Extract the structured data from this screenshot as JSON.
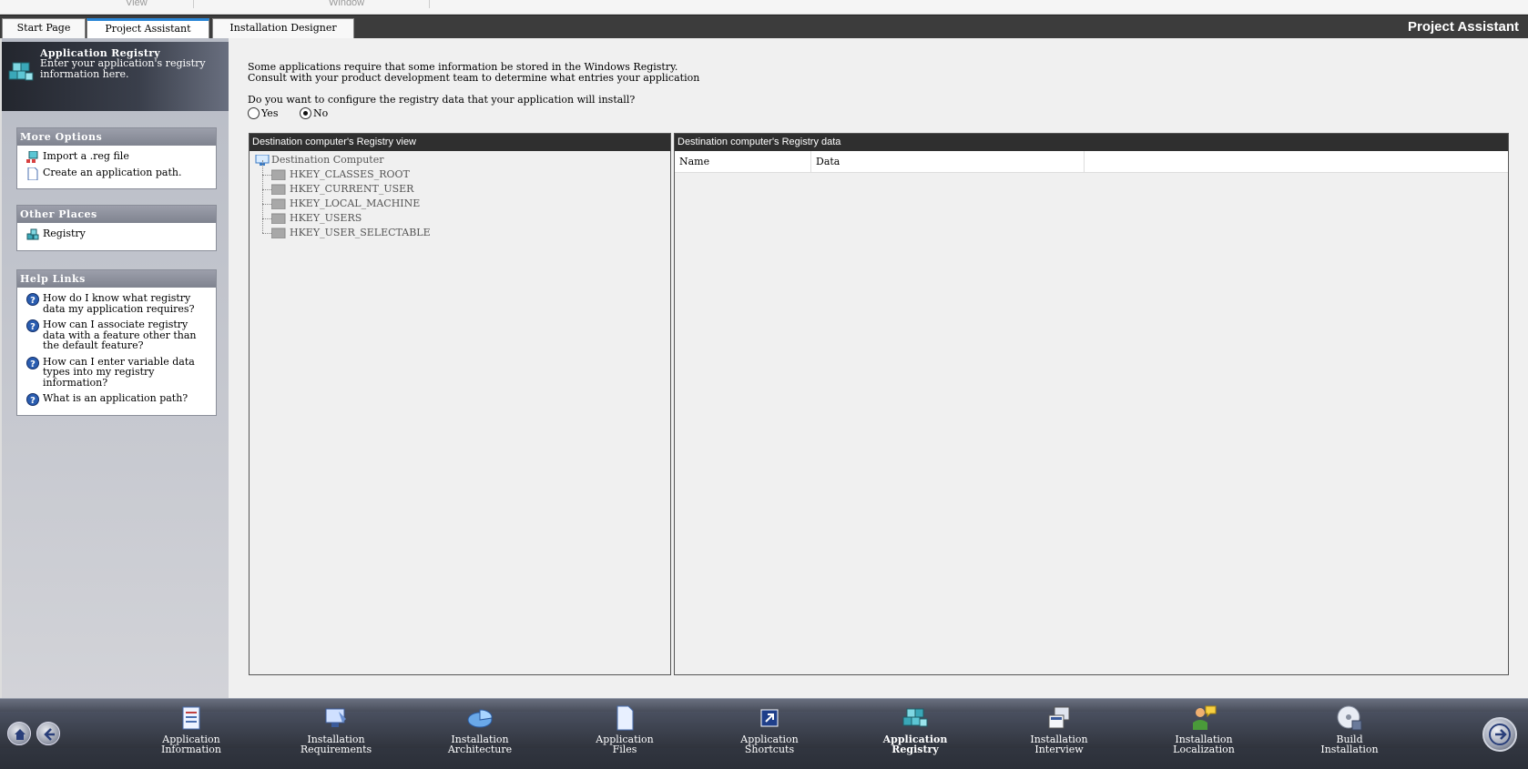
{
  "menu": {
    "view": "View",
    "window": "Window"
  },
  "tabs": [
    {
      "label": "Start Page",
      "active": false
    },
    {
      "label": "Project Assistant",
      "active": true
    },
    {
      "label": "Installation Designer",
      "active": false
    }
  ],
  "header_title": "Project Assistant",
  "sidebar": {
    "title": "Application Registry",
    "description": "Enter your application's registry information here.",
    "more_options": {
      "title": "More Options",
      "items": [
        "Import a .reg file",
        "Create an application path."
      ]
    },
    "other_places": {
      "title": "Other Places",
      "items": [
        "Registry"
      ]
    },
    "help_links": {
      "title": "Help Links",
      "items": [
        "How do I know what registry data my application requires?",
        "How can I associate registry data with a feature other than the default feature?",
        "How can I enter variable data types into my registry information?",
        "What is an application path?"
      ]
    }
  },
  "main": {
    "intro_line1": "Some applications require that some information be stored in the Windows Registry.",
    "intro_line2": "Consult with your product development team to determine what entries your application",
    "question": "Do you want to configure the registry data that your application will install?",
    "radio_yes": "Yes",
    "radio_no": "No",
    "selected": "No",
    "tree_pane_title": "Destination computer's Registry view",
    "tree": {
      "root": "Destination Computer",
      "children": [
        "HKEY_CLASSES_ROOT",
        "HKEY_CURRENT_USER",
        "HKEY_LOCAL_MACHINE",
        "HKEY_USERS",
        "HKEY_USER_SELECTABLE"
      ]
    },
    "data_pane_title": "Destination computer's Registry data",
    "data_columns": [
      "Name",
      "Data"
    ]
  },
  "bottom_nav": {
    "steps": [
      {
        "line1": "Application",
        "line2": "Information",
        "active": false
      },
      {
        "line1": "Installation",
        "line2": "Requirements",
        "active": false
      },
      {
        "line1": "Installation",
        "line2": "Architecture",
        "active": false
      },
      {
        "line1": "Application",
        "line2": "Files",
        "active": false
      },
      {
        "line1": "Application",
        "line2": "Shortcuts",
        "active": false
      },
      {
        "line1": "Application",
        "line2": "Registry",
        "active": true
      },
      {
        "line1": "Installation",
        "line2": "Interview",
        "active": false
      },
      {
        "line1": "Installation",
        "line2": "Localization",
        "active": false
      },
      {
        "line1": "Build",
        "line2": "Installation",
        "active": false
      }
    ]
  },
  "colors": {
    "tab_active_accent": "#2a86d6",
    "header_bar": "#3c3c3c",
    "pane_header": "#2f2f2f"
  }
}
